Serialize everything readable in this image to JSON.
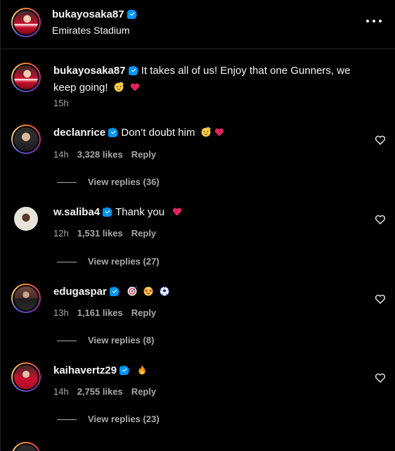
{
  "header": {
    "username": "bukayosaka87",
    "location": "Emirates Stadium"
  },
  "caption": {
    "username": "bukayosaka87",
    "text": "It takes all of us! Enjoy that one Gunners, we keep going!",
    "emojis": [
      "salute-emoji",
      "red-heart-emoji"
    ],
    "time": "15h"
  },
  "comments": [
    {
      "username": "declanrice",
      "text": "Don’t doubt him",
      "emojis": [
        "salute-emoji",
        "red-heart-emoji"
      ],
      "time": "14h",
      "likes": "3,328 likes",
      "reply": "Reply",
      "view_replies": "View replies (36)"
    },
    {
      "username": "w.saliba4",
      "text": "Thank you",
      "emojis": [
        "red-heart-emoji"
      ],
      "time": "12h",
      "likes": "1,531 likes",
      "reply": "Reply",
      "view_replies": "View replies (27)"
    },
    {
      "username": "edugaspar",
      "text": "",
      "emojis": [
        "dart-emoji",
        "star-struck-emoji",
        "soccer-ball-emoji"
      ],
      "time": "13h",
      "likes": "1,161 likes",
      "reply": "Reply",
      "view_replies": "View replies (8)"
    },
    {
      "username": "kaihavertz29",
      "text": "",
      "emojis": [
        "fire-emoji"
      ],
      "time": "14h",
      "likes": "2,755 likes",
      "reply": "Reply",
      "view_replies": "View replies (23)"
    }
  ],
  "colors": {
    "background": "#000000",
    "text": "#f5f5f5",
    "secondary_text": "#a8a8a8",
    "verified": "#0095f6",
    "divider": "#262626"
  }
}
